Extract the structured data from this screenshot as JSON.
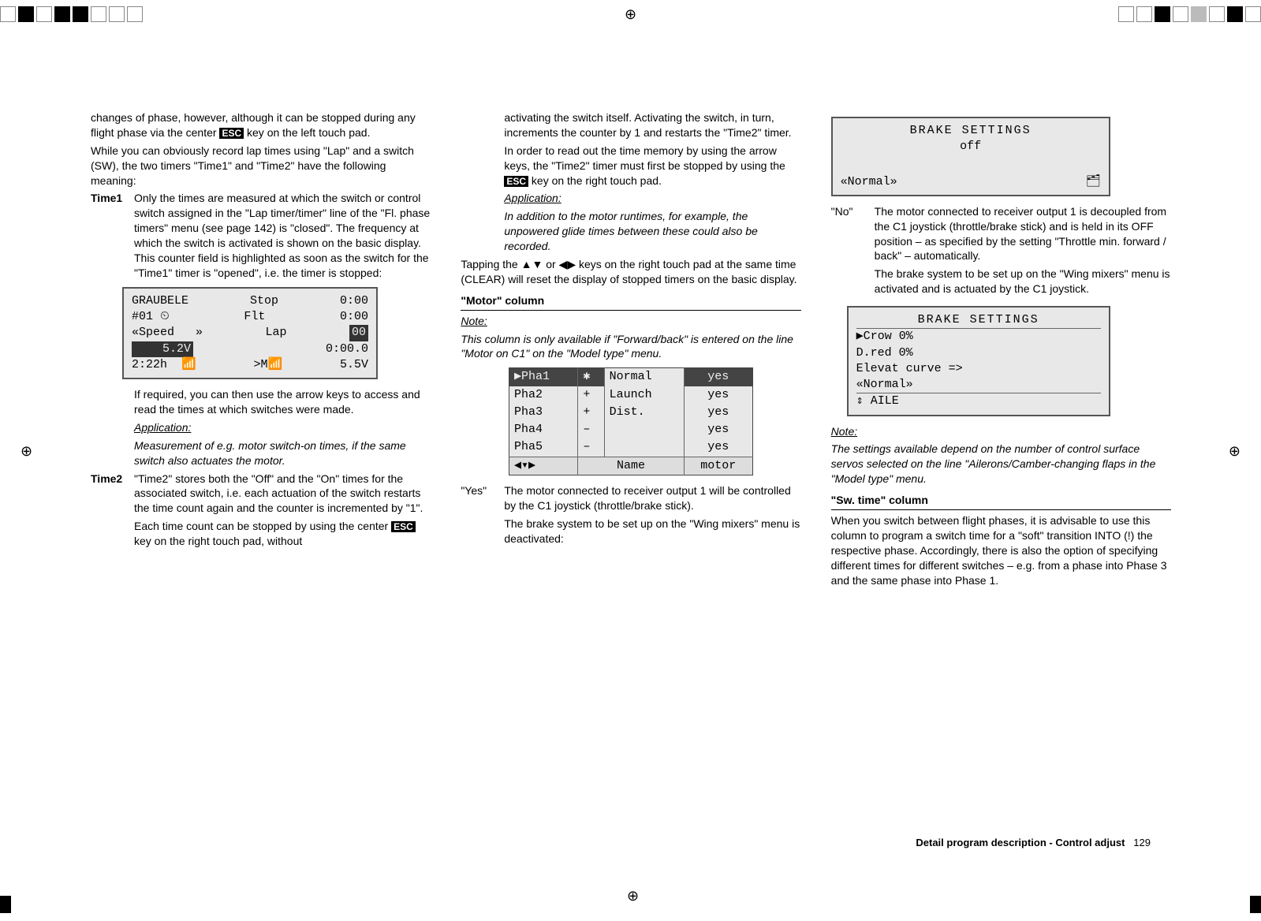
{
  "col1": {
    "p1a": "changes of phase, however, although it can be stopped during any flight phase via the center ",
    "p1b": " key on the left touch pad.",
    "p2": "While you can obviously record lap times using \"Lap\" and a switch (SW), the two timers \"Time1\" and \"Time2\" have the following meaning:",
    "t1_label": "Time1",
    "t1_body": "Only the times are measured at which the switch or control switch assigned in the \"Lap timer/timer\" line of the \"Fl. phase timers\" menu (see page 142) is \"closed\". The frequency at which the switch is activated is shown on the basic display. This counter field is highlighted as soon as the switch for the \"Time1\" timer is \"opened\", i.e. the timer is stopped:",
    "lcd1_r1_l": "GRAUBELE",
    "lcd1_r1_c": "Stop",
    "lcd1_r1_r": "0:00",
    "lcd1_r2_l": "#01 ⏲",
    "lcd1_r2_c": "Flt",
    "lcd1_r2_r": "0:00",
    "lcd1_r3_l": "«Speed   »",
    "lcd1_r3_c": "Lap",
    "lcd1_r3_r": "00",
    "lcd1_r4_l": "    5.2V",
    "lcd1_r4_r": "0:00.0",
    "lcd1_r5_l": "2:22h  📶",
    "lcd1_r5_c": ">M📶",
    "lcd1_r5_r": "5.5V",
    "t1_after": "If required, you can then use the arrow keys to access and read the times at which switches were made.",
    "app_label": "Application:",
    "t1_app": "Measurement of e.g. motor switch-on times, if the same switch also actuates the motor.",
    "t2_label": "Time2",
    "t2_body": "\"Time2\" stores both the \"Off\" and the \"On\" times for the associated switch, i.e. each actuation of the switch restarts the time count again and the counter is incremented by \"1\".",
    "t2_body2a": "Each time count can be stopped by using the center ",
    "t2_body2b": " key on the right touch pad, without"
  },
  "col2": {
    "p1": "activating the switch itself. Activating the switch, in turn, increments the counter by 1 and restarts the \"Time2\" timer.",
    "p2a": "In order to read out the time memory by using the arrow keys, the \"Time2\" timer must first be stopped by using the ",
    "p2b": " key on the right touch pad.",
    "app_label": "Application:",
    "app_body": "In addition to the motor runtimes, for example, the unpowered glide times between these could also be recorded.",
    "clear": "Tapping the ▲▼ or ◀▶ keys on the right touch pad at the same time (CLEAR) will reset the display of stopped timers on the basic display.",
    "motor_head": "\"Motor\" column",
    "note_label": "Note:",
    "note_body": "This column is only available if \"Forward/back\" is entered on the line \"Motor on C1\" on the \"Model type\" menu.",
    "tbl": {
      "rows": [
        {
          "c1": "▶Pha1",
          "c2": "✱",
          "c3": "Normal",
          "c4": "yes",
          "hl": true
        },
        {
          "c1": " Pha2",
          "c2": "+",
          "c3": "Launch",
          "c4": "yes"
        },
        {
          "c1": " Pha3",
          "c2": "+",
          "c3": "Dist.",
          "c4": "yes"
        },
        {
          "c1": " Pha4",
          "c2": "–",
          "c3": "",
          "c4": "yes"
        },
        {
          "c1": " Pha5",
          "c2": "–",
          "c3": "",
          "c4": "yes"
        }
      ],
      "f1": "◀▾▶",
      "f2": "Name",
      "f3": "motor"
    },
    "yes_label": "\"Yes\"",
    "yes_body1": "The motor connected to receiver output 1 will be controlled by the C1 joystick (throttle/brake stick).",
    "yes_body2": "The brake system to be set up on the \"Wing mixers\" menu is deactivated:"
  },
  "col3": {
    "lcd_top_title": "BRAKE  SETTINGS",
    "lcd_top_off": "off",
    "lcd_top_normal": "«Normal»",
    "no_label": "\"No\"",
    "no_body1": "The motor connected to receiver output 1 is decoupled from the C1 joystick (throttle/brake stick) and is held in its OFF position – as specified by the setting \"Throttle min. forward / back\" – automatically.",
    "no_body2": "The brake system to be set up on the \"Wing mixers\" menu is activated and is actuated by the C1 joystick.",
    "lcd2_title": "BRAKE  SETTINGS",
    "lcd2_r1": "▶Crow    0%",
    "lcd2_r2": "  D.red   0%",
    "lcd2_r3": "  Elevat curve          =>",
    "lcd2_r4": "«Normal»",
    "lcd2_r5": "   ⇕      AILE",
    "note_label": "Note:",
    "note_body": "The settings available depend on the number of control surface servos selected on the line \"Ailerons/Camber-changing flaps in the \"Model type\" menu.",
    "sw_head": "\"Sw. time\" column",
    "sw_body": "When you switch between flight phases, it is advisable to use this column to program a switch time for a \"soft\" transition INTO (!) the respective phase. Accordingly, there is also the option of specifying different times for different switches – e.g. from a phase into Phase 3 and the same phase into Phase 1."
  },
  "footer": {
    "section": "Detail program description - Control adjust",
    "page": "129"
  },
  "esc": "ESC"
}
